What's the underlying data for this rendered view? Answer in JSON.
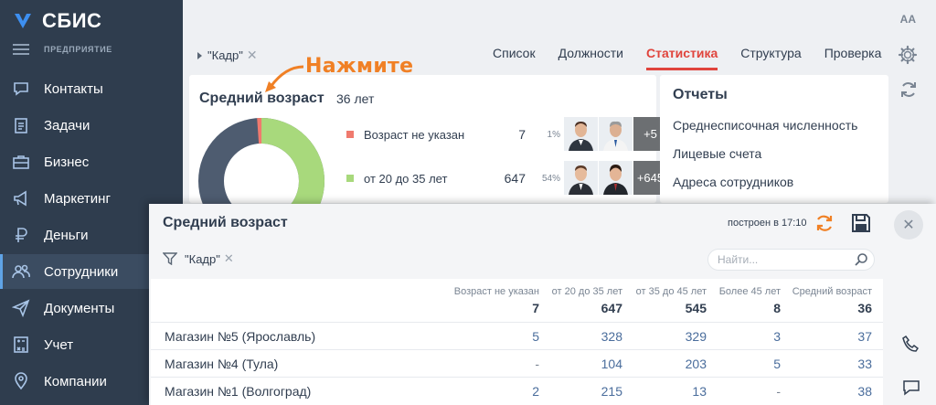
{
  "app": {
    "title": "СБИС",
    "section": "ПРЕДПРИЯТИЕ"
  },
  "sidebar": {
    "items": [
      {
        "label": "Контакты",
        "icon": "chat-icon"
      },
      {
        "label": "Задачи",
        "icon": "clipboard-icon"
      },
      {
        "label": "Бизнес",
        "icon": "briefcase-icon"
      },
      {
        "label": "Маркетинг",
        "icon": "megaphone-icon"
      },
      {
        "label": "Деньги",
        "icon": "ruble-icon"
      },
      {
        "label": "Сотрудники",
        "icon": "people-icon",
        "active": true
      },
      {
        "label": "Документы",
        "icon": "send-icon"
      },
      {
        "label": "Учет",
        "icon": "calculator-icon"
      },
      {
        "label": "Компании",
        "icon": "location-icon"
      }
    ]
  },
  "header": {
    "font_toggle": "AA",
    "filter": "\"Кадр\"",
    "tabs": [
      {
        "label": "Список"
      },
      {
        "label": "Должности"
      },
      {
        "label": "Статистика",
        "active": true
      },
      {
        "label": "Структура"
      },
      {
        "label": "Проверка"
      }
    ]
  },
  "annotation": "Нажмите",
  "stats_card": {
    "title": "Средний возраст",
    "value": "36 лет",
    "rows": [
      {
        "label": "Возраст не указан",
        "count": "7",
        "pct": "1%",
        "color": "#f07a6e",
        "more": "+5"
      },
      {
        "label": "от 20 до 35 лет",
        "count": "647",
        "pct": "54%",
        "color": "#a8d97c",
        "more": "+645"
      }
    ],
    "donut_colors": {
      "unknown": "#f07a6e",
      "age_20_35": "#a8d97c",
      "other": "#4e5c70"
    }
  },
  "reports": {
    "title": "Отчеты",
    "links": [
      "Среднесписочная численность",
      "Лицевые счета",
      "Адреса сотрудников"
    ]
  },
  "panel": {
    "title": "Средний возраст",
    "built": "построен в 17:10",
    "filter": "\"Кадр\"",
    "search_placeholder": "Найти...",
    "close": "✕",
    "columns": [
      {
        "label": "Возраст не указан",
        "total": "7"
      },
      {
        "label": "от 20 до 35 лет",
        "total": "647"
      },
      {
        "label": "от 35 до 45 лет",
        "total": "545"
      },
      {
        "label": "Более 45 лет",
        "total": "8"
      },
      {
        "label": "Средний возраст",
        "total": "36"
      }
    ],
    "rows": [
      {
        "name": "Магазин №5 (Ярославль)",
        "values": [
          "5",
          "328",
          "329",
          "3",
          "37"
        ]
      },
      {
        "name": "Магазин №4 (Тула)",
        "values": [
          "-",
          "104",
          "203",
          "5",
          "33"
        ]
      },
      {
        "name": "Магазин №1 (Волгоград)",
        "values": [
          "2",
          "215",
          "13",
          "-",
          "38"
        ]
      }
    ]
  }
}
